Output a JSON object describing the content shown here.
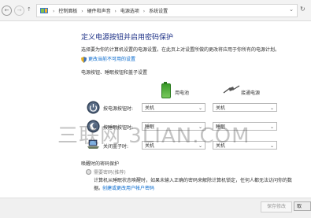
{
  "nav": {
    "back": "←",
    "forward": "→",
    "up": "↑",
    "dropdown": "⌄",
    "refresh": "↻"
  },
  "breadcrumb": {
    "sep": "›",
    "items": [
      "控制面板",
      "硬件和声音",
      "电源选项",
      "系统设置"
    ]
  },
  "page": {
    "title": "定义电源按钮并启用密码保护",
    "description": "选择要为你的计算机设置的电源设置。在此页上对设置所做的更改将应用于你所有的电源计划。",
    "change_link": "更改当前不可用的设置"
  },
  "section1": {
    "heading": "电源按钮、睡眠按钮和盖子设置",
    "col_battery": "用电池",
    "col_ac": "接通电源",
    "rows": [
      {
        "label": "按电源按钮时:",
        "battery": "关机",
        "ac": "关机"
      },
      {
        "label": "按睡眠按钮时:",
        "battery": "睡眠",
        "ac": "睡眠"
      },
      {
        "label": "关闭盖子时:",
        "battery": "关机",
        "ac": "关机"
      }
    ],
    "arrow": "⌄"
  },
  "section2": {
    "heading": "唤醒时的密码保护",
    "option_title": "需要密码(推荐)",
    "option_desc": "计算机从睡眠状态唤醒时，如果未输入正确的密码来解除计算机锁定，任何人都无法访问你的数",
    "option_desc_prefix": "据。",
    "option_link": "创建或更改用户帐户密码"
  },
  "footer": {
    "save": "保存修改",
    "cancel": "取"
  },
  "watermark": "三联网 3LIAN.COM"
}
